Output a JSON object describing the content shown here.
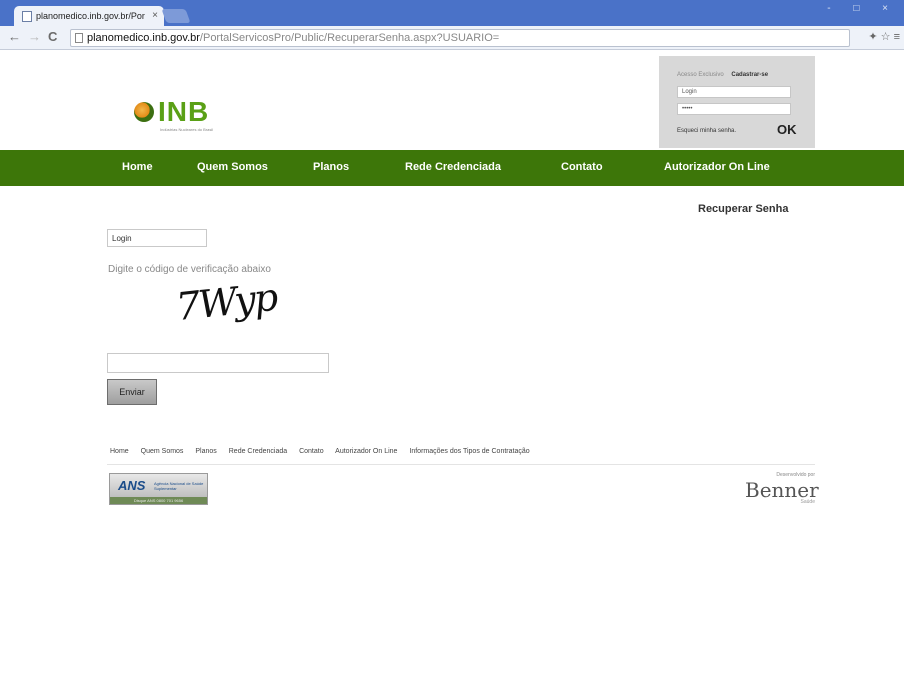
{
  "browser": {
    "tab_title": "planomedico.inb.gov.br/Por",
    "tab_close": "×",
    "url_host": "planomedico.inb.gov.br",
    "url_path": "/PortalServicosPro/Public/RecuperarSenha.aspx?USUARIO=",
    "back_glyph": "←",
    "forward_glyph": "→",
    "reload_glyph": "C",
    "window_controls": "- □ ×",
    "toolbar_icons": "✦ ☆ ≡"
  },
  "logo": {
    "text": "INB",
    "tagline": "Indústrias Nucleares do Brasil"
  },
  "login_panel": {
    "header_label": "Acesso Exclusivo",
    "register_link": "Cadastrar-se",
    "login_value": "Login",
    "password_value": "•••••",
    "forgot_link": "Esqueci minha senha.",
    "ok_label": "OK"
  },
  "nav": {
    "items": [
      {
        "label": "Home"
      },
      {
        "label": "Quem Somos"
      },
      {
        "label": "Planos"
      },
      {
        "label": "Rede Credenciada"
      },
      {
        "label": "Contato"
      },
      {
        "label": "Autorizador On Line"
      }
    ]
  },
  "page": {
    "title": "Recuperar Senha",
    "login_input_value": "Login",
    "captcha_instruction": "Digite o código de verificação abaixo",
    "captcha_text": "7Wyp",
    "code_input_value": "",
    "send_button": "Enviar"
  },
  "footer": {
    "links": [
      {
        "label": "Home"
      },
      {
        "label": "Quem Somos"
      },
      {
        "label": "Planos"
      },
      {
        "label": "Rede Credenciada"
      },
      {
        "label": "Contato"
      },
      {
        "label": "Autorizador On Line"
      },
      {
        "label": "Informações dos Tipos de Contratação"
      }
    ],
    "ans_logo_text": "ANS",
    "ans_subtext": "Agência Nacional de Saúde Suplementar",
    "ans_strip": "Disque ANS 0800 701 9656",
    "benner_small": "Desenvolvido por",
    "benner_name": "Benner",
    "benner_tag": "Saúde"
  }
}
